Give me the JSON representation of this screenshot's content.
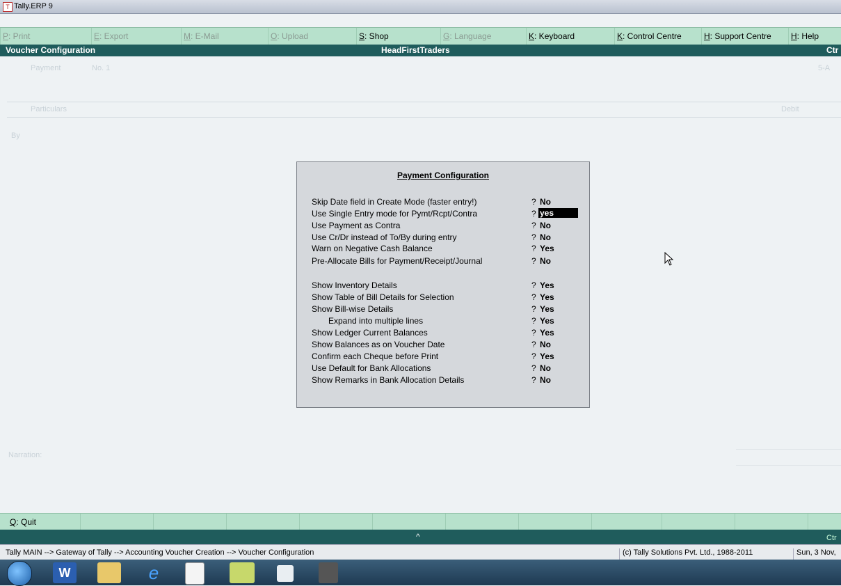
{
  "window": {
    "title": "Tally.ERP 9"
  },
  "menu": [
    {
      "key": "P",
      "label": ": Print",
      "dim": true
    },
    {
      "key": "E",
      "label": ": Export",
      "dim": true
    },
    {
      "key": "M",
      "label": ": E-Mail",
      "dim": true
    },
    {
      "key": "O",
      "label": ": Upload",
      "dim": true
    },
    {
      "key": "S",
      "label": ": Shop",
      "dim": false
    },
    {
      "key": "G",
      "label": ": Language",
      "dim": true
    },
    {
      "key": "K",
      "label": ": Keyboard",
      "dim": false
    },
    {
      "key": "K",
      "label": ": Control Centre",
      "dim": false
    },
    {
      "key": "H",
      "label": ": Support Centre",
      "dim": false
    },
    {
      "key": "H",
      "label": ": Help",
      "dim": false
    }
  ],
  "header": {
    "left": "Voucher Configuration",
    "center": "HeadFirstTraders",
    "right": "Ctr"
  },
  "background": {
    "voucher_type": "Payment",
    "voucher_no": "No. 1",
    "date_partial": "5-A",
    "col_particulars": "Particulars",
    "col_debit": "Debit",
    "by_label": "By",
    "narration": "Narration:"
  },
  "dialog": {
    "title": "Payment Configuration",
    "options": [
      {
        "label": "Skip Date field in Create Mode (faster entry!)",
        "value": "No",
        "selected": false,
        "indent": false
      },
      {
        "label": "Use Single Entry mode for Pymt/Rcpt/Contra",
        "value": "yes",
        "selected": true,
        "indent": false
      },
      {
        "label": "Use Payment as Contra",
        "value": "No",
        "selected": false,
        "indent": false
      },
      {
        "label": "Use Cr/Dr instead of To/By during entry",
        "value": "No",
        "selected": false,
        "indent": false
      },
      {
        "label": "Warn on Negative Cash Balance",
        "value": "Yes",
        "selected": false,
        "indent": false
      },
      {
        "label": "Pre-Allocate Bills for Payment/Receipt/Journal",
        "value": "No",
        "selected": false,
        "indent": false
      },
      {
        "label": "Show Inventory Details",
        "value": "Yes",
        "selected": false,
        "indent": false
      },
      {
        "label": "Show Table of Bill Details for Selection",
        "value": "Yes",
        "selected": false,
        "indent": false
      },
      {
        "label": "Show Bill-wise Details",
        "value": "Yes",
        "selected": false,
        "indent": false
      },
      {
        "label": "Expand into multiple lines",
        "value": "Yes",
        "selected": false,
        "indent": true
      },
      {
        "label": "Show Ledger Current Balances",
        "value": "Yes",
        "selected": false,
        "indent": false
      },
      {
        "label": "Show Balances as on Voucher Date",
        "value": "No",
        "selected": false,
        "indent": false
      },
      {
        "label": "Confirm each Cheque before Print",
        "value": "Yes",
        "selected": false,
        "indent": false
      },
      {
        "label": "Use Default for Bank Allocations",
        "value": "No",
        "selected": false,
        "indent": false
      },
      {
        "label": "Show Remarks in Bank Allocation Details",
        "value": "No",
        "selected": false,
        "indent": false
      }
    ],
    "question_mark": "?"
  },
  "bottom": {
    "quit_key": "Q",
    "quit_label": ": Quit",
    "arrow": "^",
    "right": "Ctr"
  },
  "status": {
    "breadcrumb": "Tally MAIN --> Gateway of Tally --> Accounting Voucher  Creation  --> Voucher Configuration",
    "copyright": "(c) Tally Solutions Pvt. Ltd., 1988-2011",
    "date": "Sun, 3 Nov,"
  },
  "taskbar": {
    "items": [
      "start-orb-icon",
      "word-icon",
      "file-manager-icon",
      "internet-explorer-icon",
      "tally-icon",
      "notes-icon",
      "document-icon",
      "app-icon"
    ]
  }
}
